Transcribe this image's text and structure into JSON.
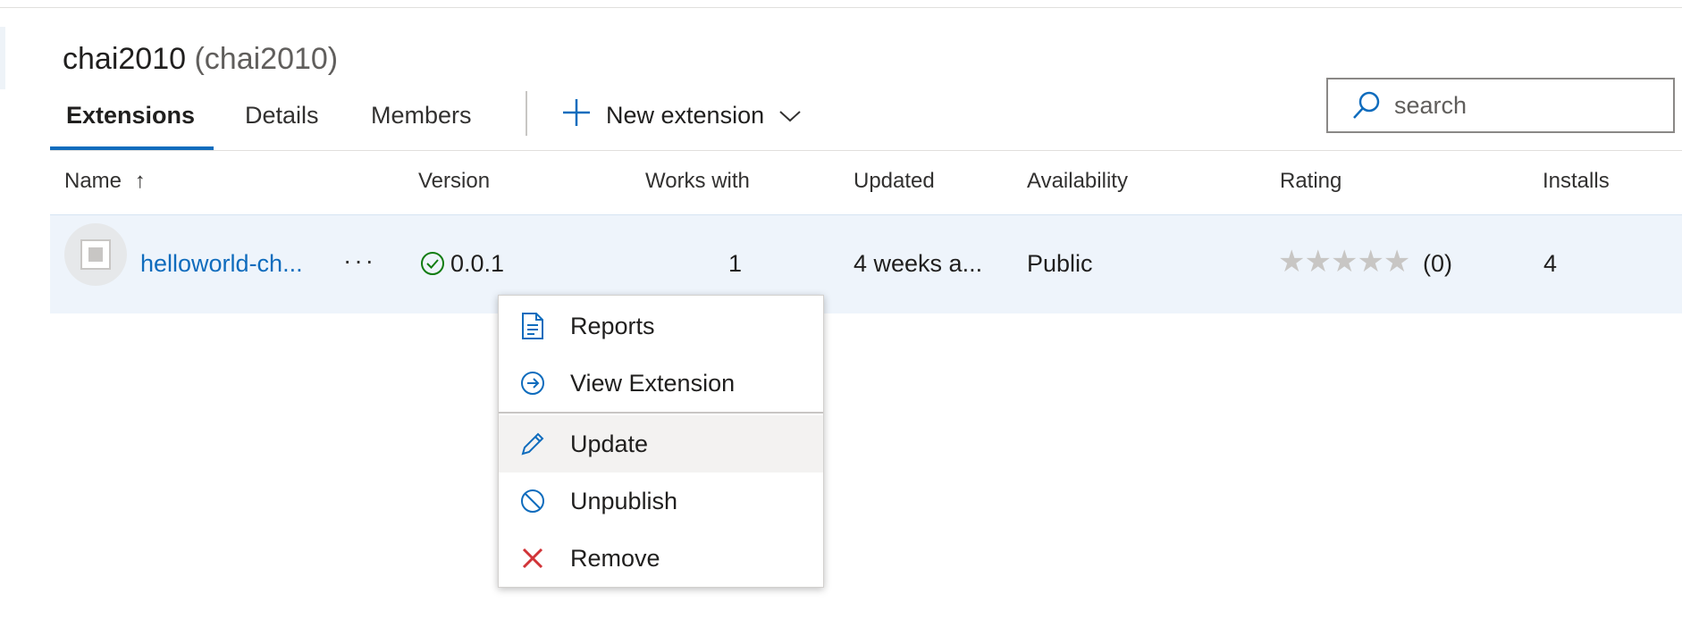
{
  "header": {
    "title": "chai2010",
    "subtitle": "(chai2010)"
  },
  "tabs": [
    {
      "label": "Extensions",
      "active": true
    },
    {
      "label": "Details",
      "active": false
    },
    {
      "label": "Members",
      "active": false
    }
  ],
  "toolbar": {
    "new_extension_label": "New extension",
    "new_extension_icon": "plus-icon"
  },
  "search": {
    "placeholder": "search",
    "value": ""
  },
  "table": {
    "columns": [
      "Name",
      "Version",
      "Works with",
      "Updated",
      "Availability",
      "Rating",
      "Installs"
    ],
    "sort_indicator": "↑",
    "rows": [
      {
        "name": "helloworld-ch...",
        "version": "0.0.1",
        "works_with": "1",
        "updated": "4 weeks a...",
        "availability": "Public",
        "rating_stars": "★★★★★",
        "rating_count": "(0)",
        "installs": "4"
      }
    ]
  },
  "context_menu": {
    "items": [
      {
        "label": "Reports",
        "icon": "document-icon"
      },
      {
        "label": "View Extension",
        "icon": "arrow-circle-right-icon"
      },
      {
        "label": "Update",
        "icon": "pencil-icon"
      },
      {
        "label": "Unpublish",
        "icon": "block-icon"
      },
      {
        "label": "Remove",
        "icon": "close-icon"
      }
    ]
  },
  "colors": {
    "accent": "#0f6cbd",
    "success": "#107c10",
    "danger": "#d13438",
    "row_selected": "#eef4fb"
  }
}
